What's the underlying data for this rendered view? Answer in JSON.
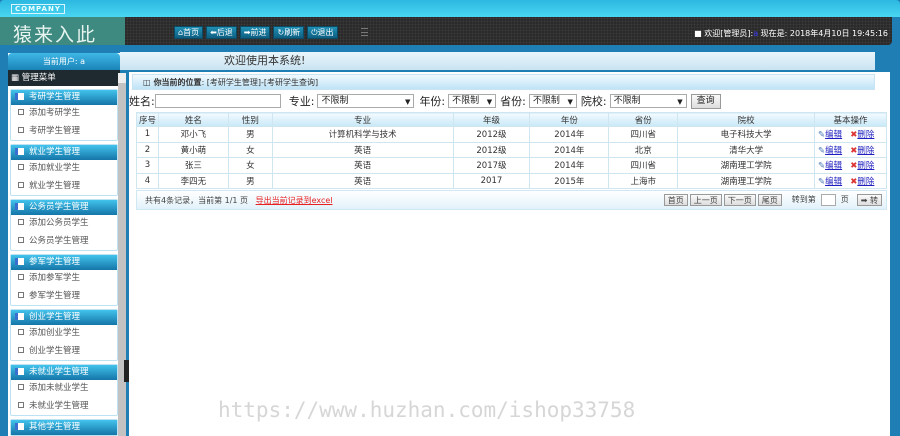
{
  "header": {
    "company": "COMPANY",
    "logo": "猿来入此",
    "nav": [
      "首页",
      "后退",
      "前进",
      "刷新",
      "退出"
    ],
    "welcome_prefix": "欢迎[管理员]:",
    "user": "a",
    "time_label": "现在是:",
    "datetime": "2018年4月10日 19:45:16"
  },
  "sidebar": {
    "current_user": "当前用户: a",
    "menu_title": "管理菜单",
    "groups": [
      {
        "title": "考研学生管理",
        "items": [
          "添加考研学生",
          "考研学生管理"
        ]
      },
      {
        "title": "就业学生管理",
        "items": [
          "添加就业学生",
          "就业学生管理"
        ]
      },
      {
        "title": "公务员学生管理",
        "items": [
          "添加公务员学生",
          "公务员学生管理"
        ]
      },
      {
        "title": "参军学生管理",
        "items": [
          "添加参军学生",
          "参军学生管理"
        ]
      },
      {
        "title": "创业学生管理",
        "items": [
          "添加创业学生",
          "创业学生管理"
        ]
      },
      {
        "title": "未就业学生管理",
        "items": [
          "添加未就业学生",
          "未就业学生管理"
        ]
      },
      {
        "title": "其他学生管理",
        "items": []
      }
    ]
  },
  "welcome": "欢迎使用本系统!",
  "breadcrumb": {
    "label": "你当前的位置",
    "path": ": [考研学生管理]-[考研学生查询]"
  },
  "filter": {
    "name_label": "姓名:",
    "name_value": "",
    "major_label": "专业:",
    "major": "不限制",
    "year_label": "年份:",
    "year": "不限制",
    "province_label": "省份:",
    "province": "不限制",
    "school_label": "院校:",
    "school": "不限制",
    "search": "查询"
  },
  "table": {
    "headers": [
      "序号",
      "姓名",
      "性别",
      "专业",
      "年级",
      "年份",
      "省份",
      "院校",
      "基本操作"
    ],
    "rows": [
      [
        "1",
        "邓小飞",
        "男",
        "计算机科学与技术",
        "2012级",
        "2014年",
        "四川省",
        "电子科技大学"
      ],
      [
        "2",
        "黄小萌",
        "女",
        "英语",
        "2012级",
        "2014年",
        "北京",
        "清华大学"
      ],
      [
        "3",
        "张三",
        "女",
        "英语",
        "2017级",
        "2014年",
        "四川省",
        "湖南理工学院"
      ],
      [
        "4",
        "李四无",
        "男",
        "英语",
        "2017",
        "2015年",
        "上海市",
        "湖南理工学院"
      ]
    ],
    "edit": "编辑",
    "delete": "删除"
  },
  "footer": {
    "summary": "共有4条记录，当前第 1/1 页",
    "export": "导出当前记录到excel",
    "first": "首页",
    "prev": "上一页",
    "next": "下一页",
    "last": "尾页",
    "goto": "转到第",
    "page_unit": "页",
    "go": "➡ 转"
  },
  "watermark": "https://www.huzhan.com/ishop33758"
}
